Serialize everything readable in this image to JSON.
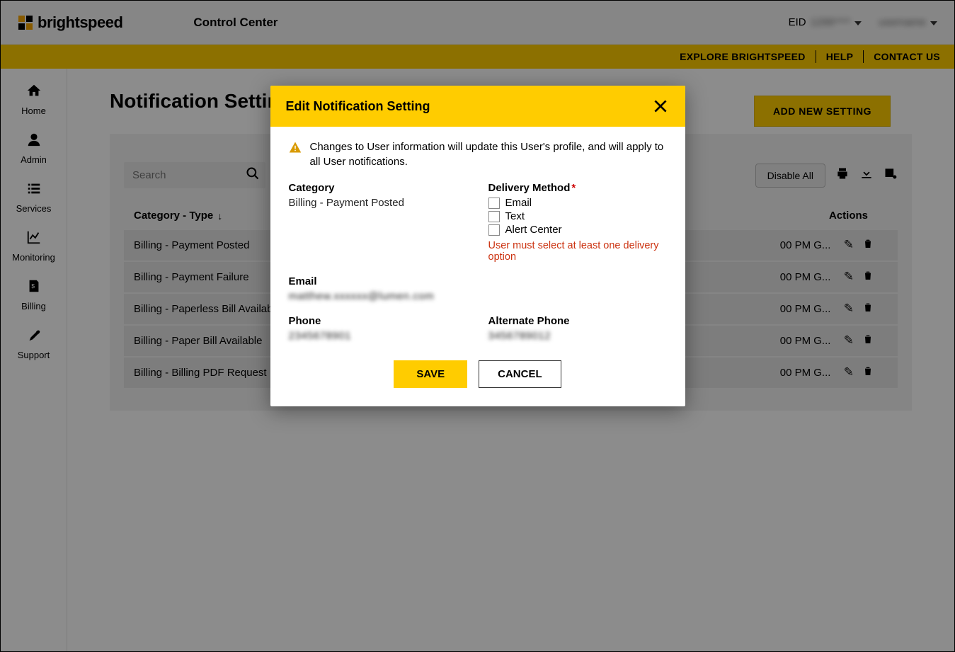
{
  "header": {
    "brand": "brightspeed",
    "app": "Control Center",
    "eid_label": "EID",
    "eid_value": "1296****",
    "user_value": "username"
  },
  "subnav": {
    "explore": "EXPLORE BRIGHTSPEED",
    "help": "HELP",
    "contact": "CONTACT US"
  },
  "sidebar": {
    "items": [
      {
        "icon": "home-icon",
        "label": "Home"
      },
      {
        "icon": "admin-icon",
        "label": "Admin"
      },
      {
        "icon": "services-icon",
        "label": "Services"
      },
      {
        "icon": "monitoring-icon",
        "label": "Monitoring"
      },
      {
        "icon": "billing-icon",
        "label": "Billing"
      },
      {
        "icon": "support-icon",
        "label": "Support"
      }
    ]
  },
  "page": {
    "title": "Notification Settings",
    "add_button": "ADD NEW SETTING",
    "search_placeholder": "Search",
    "disable_all": "Disable All"
  },
  "table": {
    "headers": {
      "category": "Category - Type",
      "actions": "Actions"
    },
    "rows": [
      {
        "category": "Billing - Payment Posted",
        "date": "00 PM G..."
      },
      {
        "category": "Billing - Payment Failure",
        "date": "00 PM G..."
      },
      {
        "category": "Billing - Paperless Bill Available",
        "date": "00 PM G..."
      },
      {
        "category": "Billing - Paper Bill Available",
        "date": "00 PM G..."
      },
      {
        "category": "Billing - Billing PDF Request",
        "date": "00 PM G..."
      }
    ]
  },
  "modal": {
    "title": "Edit Notification Setting",
    "warning": "Changes to User information will update this User's profile, and will apply to all User notifications.",
    "category_label": "Category",
    "category_value": "Billing - Payment Posted",
    "delivery_label": "Delivery Method",
    "delivery_options": {
      "email": "Email",
      "text": "Text",
      "alert_center": "Alert Center"
    },
    "delivery_error": "User must select at least one delivery option",
    "email_label": "Email",
    "email_value": "matthew.xxxxxx@lumen.com",
    "phone_label": "Phone",
    "phone_value": "2345678901",
    "alt_phone_label": "Alternate Phone",
    "alt_phone_value": "3456789012",
    "save": "SAVE",
    "cancel": "CANCEL"
  }
}
